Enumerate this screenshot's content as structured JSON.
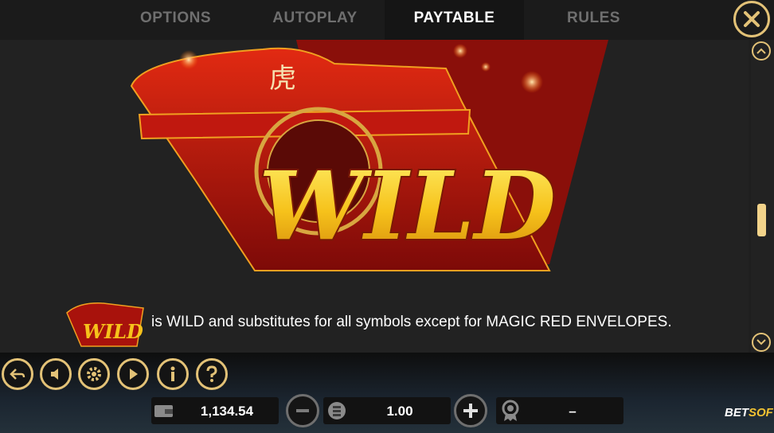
{
  "tabs": [
    {
      "label": "OPTIONS",
      "active": false
    },
    {
      "label": "AUTOPLAY",
      "active": false
    },
    {
      "label": "PAYTABLE",
      "active": true
    },
    {
      "label": "RULES",
      "active": false
    }
  ],
  "symbol": {
    "name": "WILD",
    "emblem_char": "虎",
    "description": "is WILD and substitutes for all symbols except for MAGIC RED ENVELOPES."
  },
  "balance": "1,134.54",
  "bet": "1.00",
  "win": "–",
  "brand": {
    "part1": "BET",
    "part2": "SOFT"
  },
  "colors": {
    "accent": "#e3c277",
    "wild_gold": "#f6c21b",
    "envelope_red": "#b3140c"
  },
  "icons": [
    "close-icon",
    "scroll-up-icon",
    "scroll-down-icon",
    "back-icon",
    "sound-icon",
    "settings-icon",
    "play-icon",
    "info-icon",
    "help-icon",
    "wallet-icon",
    "minus-icon",
    "coins-icon",
    "plus-icon",
    "award-icon"
  ]
}
